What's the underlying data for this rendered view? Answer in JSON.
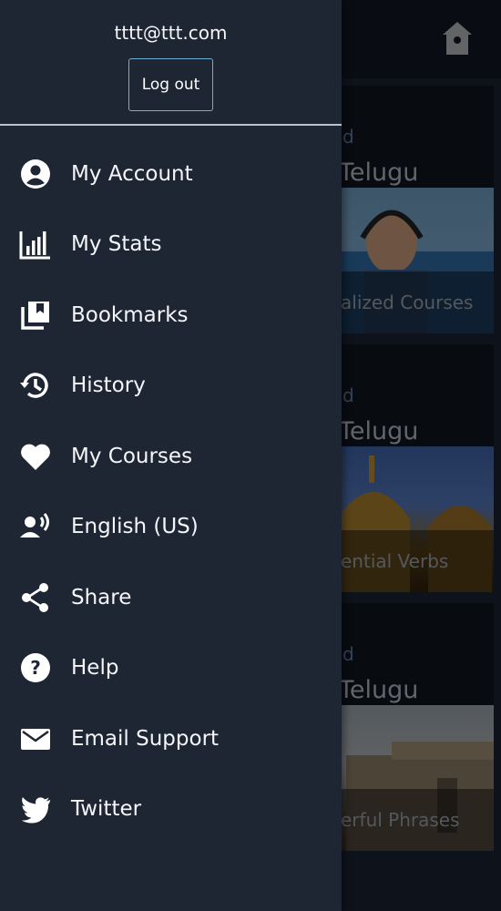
{
  "user": {
    "email": "tttt@ttt.com",
    "logout_label": "Log out"
  },
  "menu": [
    {
      "label": "My Account",
      "icon": "account-icon"
    },
    {
      "label": "My Stats",
      "icon": "stats-icon"
    },
    {
      "label": "Bookmarks",
      "icon": "bookmarks-icon"
    },
    {
      "label": "History",
      "icon": "history-icon"
    },
    {
      "label": "My Courses",
      "icon": "heart-icon"
    },
    {
      "label": "English (US)",
      "icon": "voice-icon"
    },
    {
      "label": "Share",
      "icon": "share-icon"
    },
    {
      "label": "Help",
      "icon": "help-icon"
    },
    {
      "label": "Email Support",
      "icon": "email-icon"
    },
    {
      "label": "Twitter",
      "icon": "twitter-icon"
    }
  ],
  "background": {
    "cards": [
      {
        "level": "d",
        "language": "Telugu",
        "caption": "alized Courses"
      },
      {
        "level": "d",
        "language": "Telugu",
        "caption": "ential Verbs"
      },
      {
        "level": "d",
        "language": "Telugu",
        "caption": "erful Phrases"
      }
    ]
  },
  "colors": {
    "drawer_bg": "#1e2533",
    "accent_border": "#6fb0d4",
    "text": "#f4f6f9"
  }
}
